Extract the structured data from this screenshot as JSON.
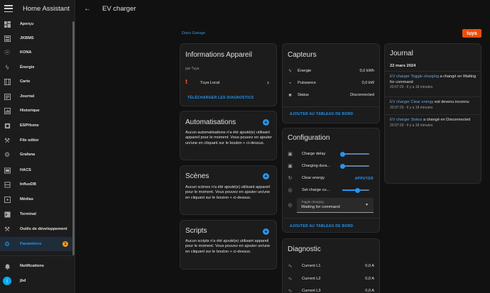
{
  "sidebar": {
    "title": "Home Assistant",
    "items": [
      {
        "label": "Aperçu",
        "icon": "dashboard-icon"
      },
      {
        "label": "JKBMS",
        "icon": "battery-icon"
      },
      {
        "label": "KONA",
        "icon": "car-icon"
      },
      {
        "label": "Énergie",
        "icon": "lightning-icon"
      },
      {
        "label": "Carte",
        "icon": "map-icon"
      },
      {
        "label": "Journal",
        "icon": "list-icon"
      },
      {
        "label": "Historique",
        "icon": "chart-icon"
      },
      {
        "label": "ESPHome",
        "icon": "chip-icon"
      },
      {
        "label": "File editor",
        "icon": "wrench-icon"
      },
      {
        "label": "Grafana",
        "icon": "grafana-icon"
      },
      {
        "label": "HACS",
        "icon": "hacs-icon"
      },
      {
        "label": "InfluxDB",
        "icon": "database-icon"
      },
      {
        "label": "Médias",
        "icon": "play-icon"
      },
      {
        "label": "Terminal",
        "icon": "terminal-icon"
      },
      {
        "label": "Outils de développement",
        "icon": "hammer-icon"
      },
      {
        "label": "Paramètres",
        "icon": "gear-icon",
        "badge": "1"
      }
    ],
    "notifications": "Notifications",
    "user_name": "jbd",
    "user_initial": "j"
  },
  "header": {
    "title": "EV charger"
  },
  "breadcrumb": "Dans Garage",
  "brand_logo_text": "tuya",
  "device_info": {
    "title": "Informations Appareil",
    "by": "par Tuya",
    "integration": "Tuya Local",
    "download_label": "TÉLÉCHARGER LES DIAGNOSTICS"
  },
  "automations": {
    "title": "Automatisations",
    "text": "Aucun automatisations n'a été ajouté(e) utilisant appareil pour le moment. Vous pouvez en ajouter un/une en cliquant sur le bouton + ci-dessus."
  },
  "scenes": {
    "title": "Scènes",
    "text": "Aucun scènes n'a été ajouté(e) utilisant appareil pour le moment. Vous pouvez en ajouter un/une en cliquant sur le bouton + ci-dessus."
  },
  "scripts": {
    "title": "Scripts",
    "text": "Aucun scripts n'a été ajouté(e) utilisant appareil pour le moment. Vous pouvez en ajouter un/une en cliquant sur le bouton + ci-dessus."
  },
  "sensors": {
    "title": "Capteurs",
    "rows": [
      {
        "name": "Énergie",
        "value": "0,0 kWh"
      },
      {
        "name": "Puissance",
        "value": "0,0 kW"
      },
      {
        "name": "Status",
        "value": "Disconnected"
      }
    ],
    "add_label": "AJOUTER AU TABLEAU DE BORD"
  },
  "configuration": {
    "title": "Configuration",
    "charge_delay": {
      "label": "Charge delay",
      "level": 0.05
    },
    "charging_duration": {
      "label": "Charging dura...",
      "level": 0.05
    },
    "clear_energy": {
      "label": "Clear energy",
      "button": "APPUYER"
    },
    "set_charge_current": {
      "label": "Set charge cu...",
      "level": 0.55
    },
    "toggle": {
      "label": "Toggle charging",
      "value": "Waiting for command"
    },
    "add_label": "AJOUTER AU TABLEAU DE BORD"
  },
  "diagnostic": {
    "title": "Diagnostic",
    "rows": [
      {
        "name": "Current L1",
        "value": "0,0 A"
      },
      {
        "name": "Current L2",
        "value": "0,0 A"
      },
      {
        "name": "Current L3",
        "value": "0,0 A"
      }
    ]
  },
  "journal": {
    "title": "Journal",
    "date": "22 mars 2024",
    "entries": [
      {
        "entity": "EV charger Toggle charging",
        "text": " a changé en Waiting for command",
        "time": "20:07:29 - Il y a 18 minutes"
      },
      {
        "entity": "EV charger Clear energy",
        "text": " est devenu inconnu",
        "time": "20:07:29 - Il y a 18 minutes"
      },
      {
        "entity": "EV charger Status",
        "text": " a changé en Disconnected",
        "time": "20:07:29 - Il y a 18 minutes"
      }
    ]
  },
  "colors": {
    "accent": "#2196f3",
    "badge": "#ff9800",
    "brand": "#ff4800"
  }
}
